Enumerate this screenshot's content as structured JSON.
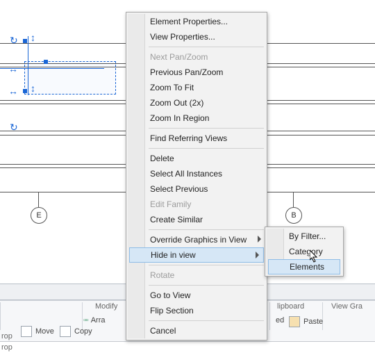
{
  "grid": {
    "bubbleE": "E",
    "bubbleB": "B"
  },
  "ribbon": {
    "groups": {
      "clipboard": "lipboard",
      "viewGr": "View Gra"
    },
    "tools": {
      "paste": "Paste",
      "modify": "Modify",
      "array": "Arra",
      "move": "Move",
      "copy": "Copy",
      "ed": "ed"
    },
    "tabs": {
      "op1": "rop",
      "op2": "rop"
    }
  },
  "menu": {
    "cancel": "Cancel",
    "flipSection": "Flip Section",
    "goToView": "Go to View",
    "rotate": "Rotate",
    "hideInView": "Hide in view",
    "override": "Override Graphics in View",
    "createSimilar": "Create Similar",
    "editFamily": "Edit Family",
    "selectPrevious": "Select Previous",
    "selectAll": "Select All Instances",
    "delete": "Delete",
    "findRef": "Find Referring Views",
    "zoomRegion": "Zoom In Region",
    "zoomOut": "Zoom Out (2x)",
    "zoomFit": "Zoom To Fit",
    "prevPan": "Previous Pan/Zoom",
    "nextPan": "Next Pan/Zoom",
    "viewProps": "View Properties...",
    "elemProps": "Element Properties..."
  },
  "submenu": {
    "elements": "Elements",
    "category": "Category",
    "byFilter": "By Filter..."
  }
}
